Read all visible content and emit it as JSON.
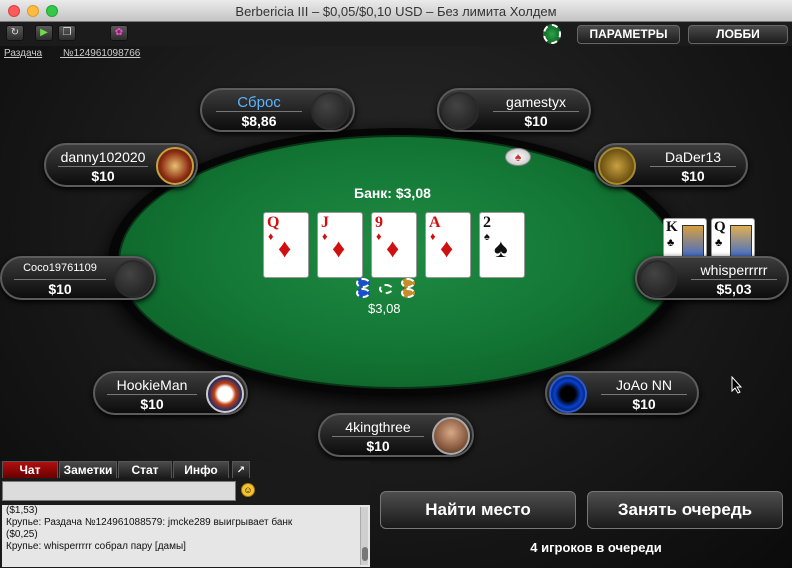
{
  "window": {
    "title": "Berbericia III – $0,05/$0,10 USD – Без лимита Холдем"
  },
  "toolbar": {
    "options_label": "ПАРАМЕТРЫ",
    "lobby_label": "ЛОББИ"
  },
  "hand": {
    "label": "Раздача",
    "number": "№124961098766"
  },
  "pot": {
    "total": "Банк: $3,08",
    "chips_amount": "$3,08"
  },
  "board": [
    {
      "rank": "Q",
      "suit": "♦",
      "color": "red"
    },
    {
      "rank": "J",
      "suit": "♦",
      "color": "red"
    },
    {
      "rank": "9",
      "suit": "♦",
      "color": "red"
    },
    {
      "rank": "A",
      "suit": "♦",
      "color": "red"
    },
    {
      "rank": "2",
      "suit": "♠",
      "color": "black"
    }
  ],
  "seats": {
    "fold": {
      "name": "Сброс",
      "stack": "$8,86"
    },
    "gamestyx": {
      "name": "gamestyx",
      "stack": "$10"
    },
    "danny": {
      "name": "danny102020",
      "stack": "$10"
    },
    "dader": {
      "name": "DaDer13",
      "stack": "$10"
    },
    "coco": {
      "name": "Coco19761109",
      "stack": "$10"
    },
    "whisper": {
      "name": "whisperrrrr",
      "stack": "$5,03"
    },
    "hookie": {
      "name": "HookieMan",
      "stack": "$10"
    },
    "joao": {
      "name": "JoAo NN",
      "stack": "$10"
    },
    "king": {
      "name": "4kingthree",
      "stack": "$10"
    }
  },
  "whisper_cards": [
    {
      "rank": "K",
      "suit": "♣"
    },
    {
      "rank": "Q",
      "suit": "♣"
    }
  ],
  "chat": {
    "tabs": [
      "Чат",
      "Заметки",
      "Стат",
      "Инфо"
    ],
    "lines": [
      "($1,53)",
      "Крупье: Раздача №124961088579: jmcke289 выигрывает банк",
      "($0,25)",
      "Крупье: whisperrrrr собрал пару [дамы]"
    ]
  },
  "actions": {
    "find_seat": "Найти место",
    "join_queue": "Занять очередь",
    "queue_status": "4 игроков в очереди"
  },
  "colors": {
    "felt": "#127433",
    "fold_name": "#5ab4ff",
    "active_tab": "#8b0000"
  }
}
